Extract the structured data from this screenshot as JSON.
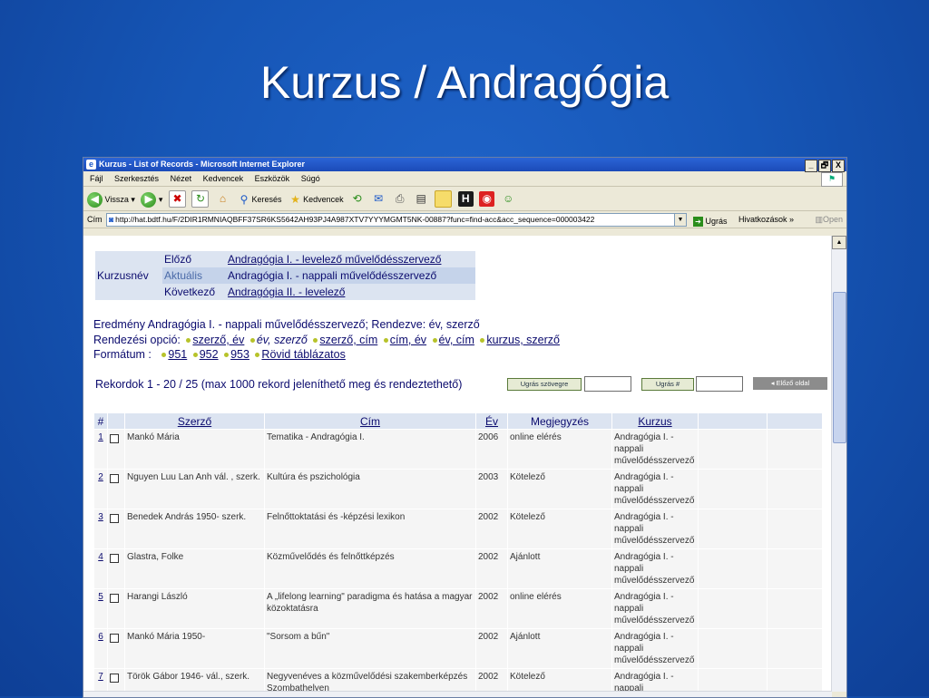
{
  "slide": {
    "title": "Kurzus / Andragógia"
  },
  "window": {
    "title": "Kurzus - List of Records - Microsoft Internet Explorer",
    "controls": [
      "_",
      "🗗",
      "X"
    ]
  },
  "menu": [
    "Fájl",
    "Szerkesztés",
    "Nézet",
    "Kedvencek",
    "Eszközök",
    "Súgó"
  ],
  "toolbar": {
    "back": "Vissza",
    "search": "Keresés",
    "favorites": "Kedvencek"
  },
  "address": {
    "label": "Cím",
    "url": "http://hat.bdtf.hu/F/2DIR1RMNIAQBFF37SR6KS5642AH93PJ4A987XTV7YYYMGMT5NK-00887?func=find-acc&acc_sequence=000003422",
    "go": "Ugrás",
    "links": "Hivatkozások",
    "links_chev": "»",
    "open": "Open"
  },
  "nav": {
    "course_label": "Kurzusnév",
    "rows": [
      {
        "label": "Előző",
        "value": "Andragógia I. - levelező művelődésszervező",
        "link": true
      },
      {
        "label": "Aktuális",
        "value": "Andragógia I. - nappali művelődésszervező",
        "link": false
      },
      {
        "label": "Következő",
        "value": "Andragógia II. - levelező",
        "link": true
      }
    ]
  },
  "result": {
    "line": "Eredmény Andragógia I. - nappali művelődésszervező; Rendezve: év, szerző",
    "sort_label": "Rendezési opció:",
    "sort_options": [
      "szerző, év",
      "év, szerző",
      "szerző, cím",
      "cím, év",
      "év, cím",
      "kurzus, szerző"
    ],
    "format_label": "Formátum :",
    "formats": [
      "951",
      "952",
      "953",
      "Rövid táblázatos"
    ]
  },
  "records_line": "Rekordok 1 - 20 / 25 (max 1000 rekord jeleníthető meg és rendeztethető)",
  "buttons": {
    "jump_text": "Ugrás szövegre",
    "jump_num": "Ugrás #",
    "prev_page": "Előző oldal"
  },
  "table": {
    "headers": [
      "#",
      "Szerző",
      "Cím",
      "Év",
      "Megjegyzés",
      "Kurzus"
    ],
    "rows": [
      {
        "num": "1",
        "author": "Mankó Mária",
        "title": "Tematika - Andragógia I.",
        "year": "2006",
        "note": "online elérés",
        "course": "Andragógia I. - nappali művelődésszervező"
      },
      {
        "num": "2",
        "author": "Nguyen Luu Lan Anh vál. , szerk.",
        "title": "Kultúra és pszichológia",
        "year": "2003",
        "note": "Kötelező",
        "course": "Andragógia I. - nappali művelődésszervező"
      },
      {
        "num": "3",
        "author": "Benedek András 1950- szerk.",
        "title": "Felnőttoktatási és -képzési lexikon",
        "year": "2002",
        "note": "Kötelező",
        "course": "Andragógia I. - nappali művelődésszervező"
      },
      {
        "num": "4",
        "author": "Glastra, Folke",
        "title": "Közművelődés és felnőttképzés",
        "year": "2002",
        "note": "Ajánlott",
        "course": "Andragógia I. - nappali művelődésszervező"
      },
      {
        "num": "5",
        "author": "Harangi László",
        "title": "A „lifelong learning\" paradigma és hatása a magyar közoktatásra",
        "year": "2002",
        "note": "online elérés",
        "course": "Andragógia I. - nappali művelődésszervező"
      },
      {
        "num": "6",
        "author": "Mankó Mária 1950-",
        "title": "\"Sorsom a bűn\"",
        "year": "2002",
        "note": "Ajánlott",
        "course": "Andragógia I. - nappali művelődésszervező"
      },
      {
        "num": "7",
        "author": "Török Gábor 1946- vál., szerk.",
        "title": "Negyvenéves a közművelődési szakemberképzés Szombathelyen",
        "year": "2002",
        "note": "Kötelező",
        "course": "Andragógia I. - nappali"
      }
    ]
  }
}
